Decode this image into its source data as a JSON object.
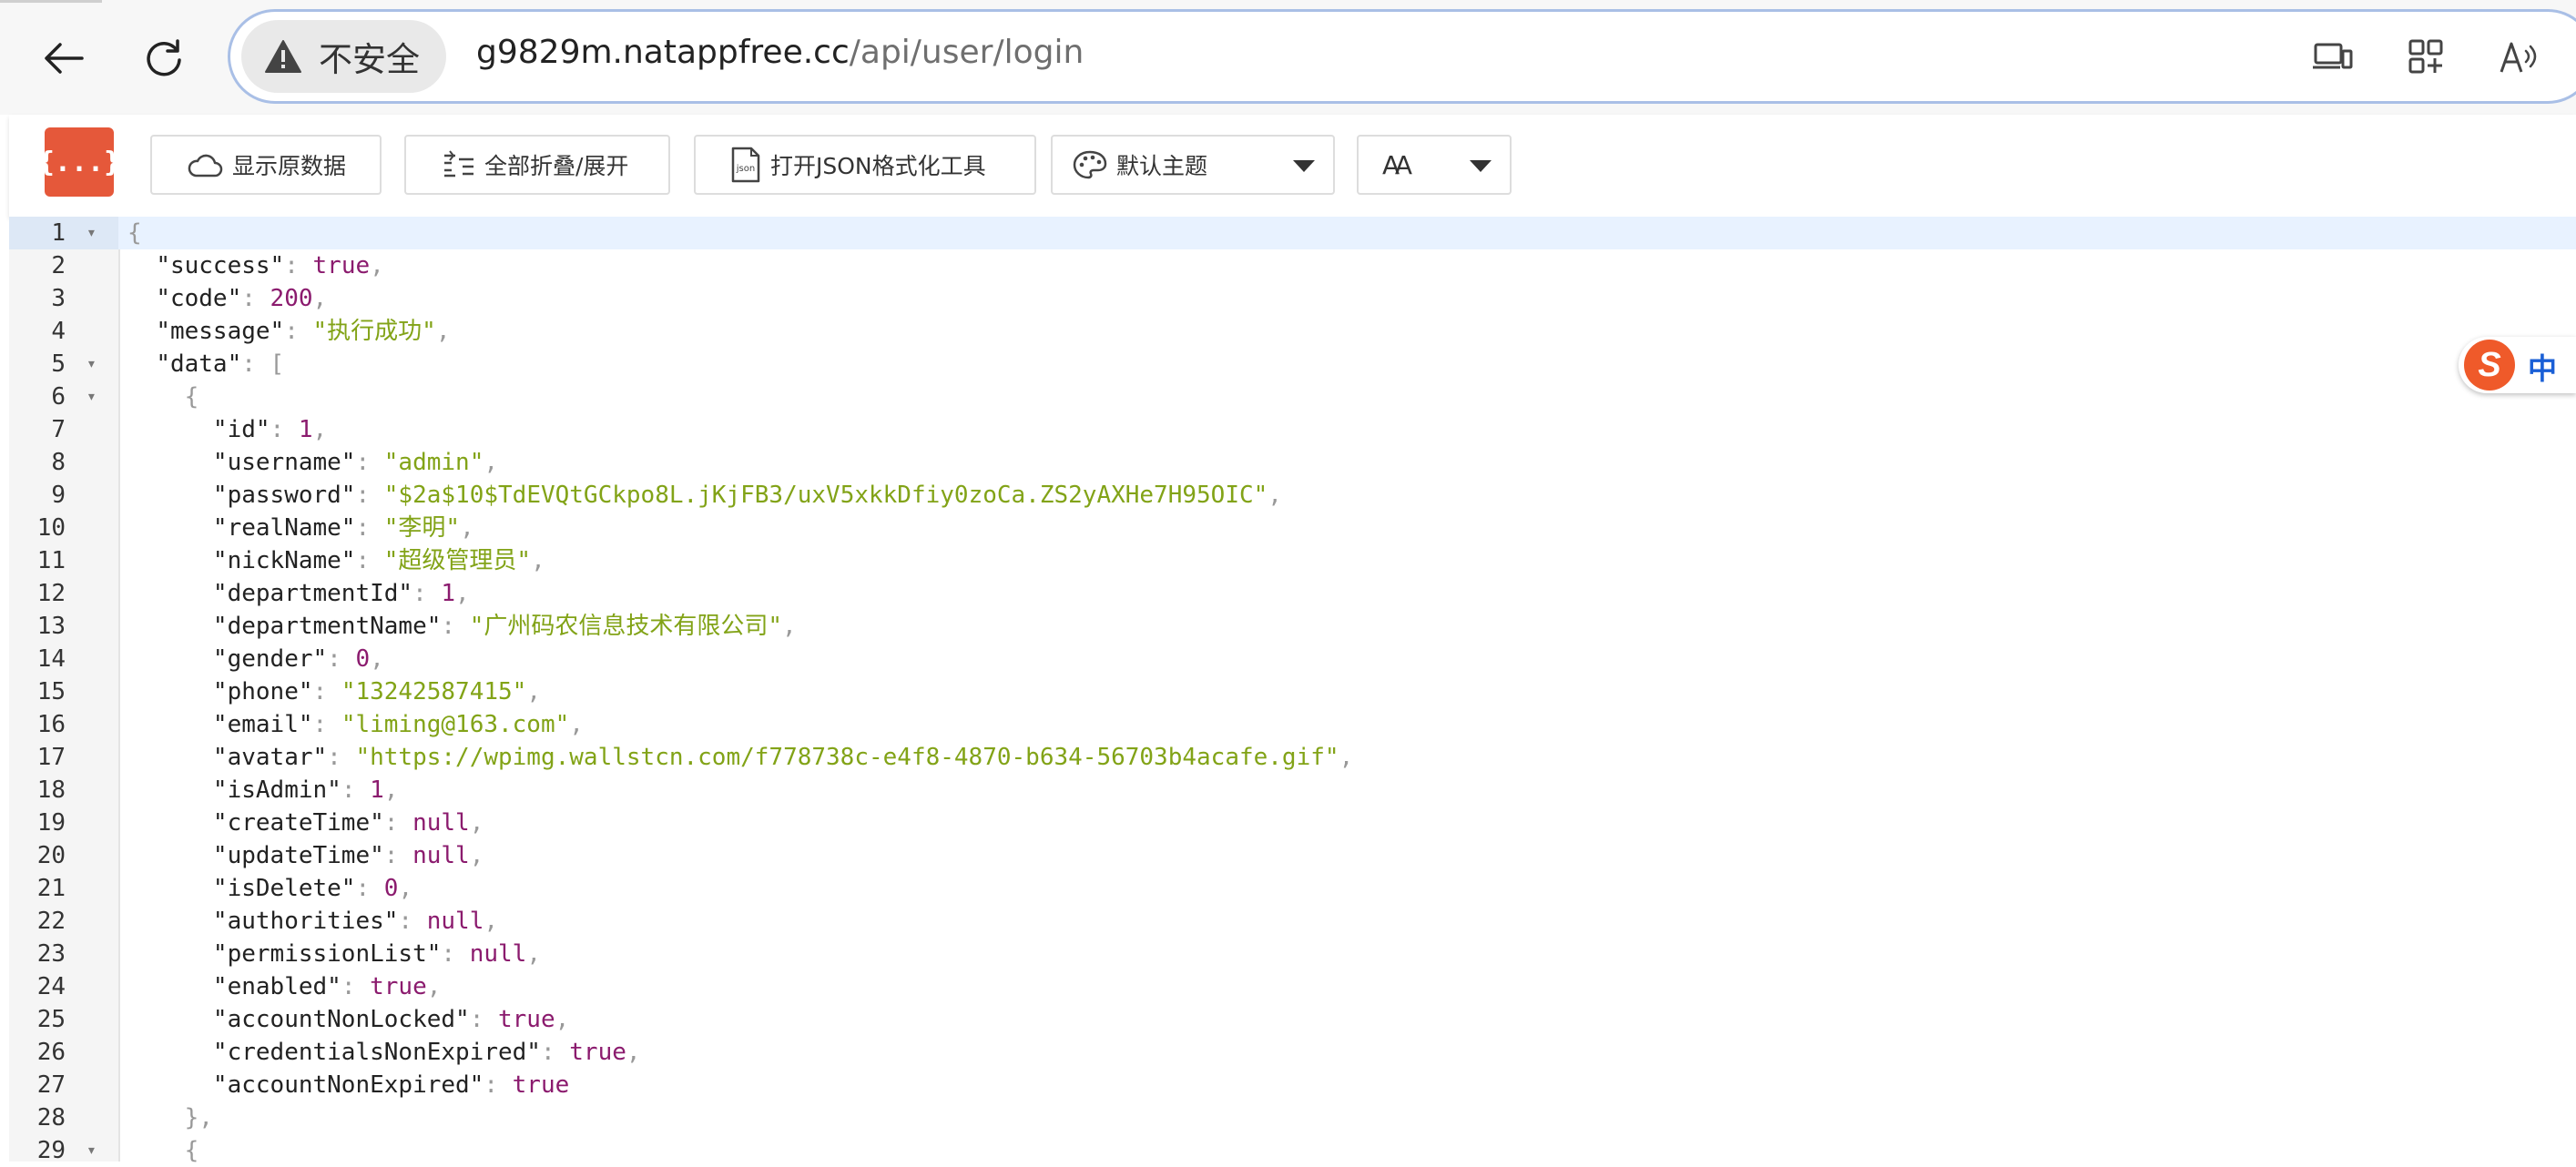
{
  "browser": {
    "security_label": "不安全",
    "url_host": "g9829m.natappfree.cc",
    "url_path": "/api/user/login"
  },
  "toolbar": {
    "logo_text": "{...}",
    "raw_button": "显示原数据",
    "fold_button": "全部折叠/展开",
    "formatter_button": "打开JSON格式化工具",
    "theme_select": "默认主题",
    "font_select": "AA"
  },
  "ime": {
    "logo": "S",
    "mode": "中"
  },
  "code": {
    "lines": [
      {
        "n": "1",
        "fold": "▾",
        "parts": [
          {
            "t": "{",
            "c": "p"
          }
        ]
      },
      {
        "n": "2",
        "fold": "",
        "parts": [
          {
            "t": "  ",
            "c": "p"
          },
          {
            "t": "\"success\"",
            "c": "k"
          },
          {
            "t": ": ",
            "c": "p"
          },
          {
            "t": "true",
            "c": "b"
          },
          {
            "t": ",",
            "c": "p"
          }
        ]
      },
      {
        "n": "3",
        "fold": "",
        "parts": [
          {
            "t": "  ",
            "c": "p"
          },
          {
            "t": "\"code\"",
            "c": "k"
          },
          {
            "t": ": ",
            "c": "p"
          },
          {
            "t": "200",
            "c": "n"
          },
          {
            "t": ",",
            "c": "p"
          }
        ]
      },
      {
        "n": "4",
        "fold": "",
        "parts": [
          {
            "t": "  ",
            "c": "p"
          },
          {
            "t": "\"message\"",
            "c": "k"
          },
          {
            "t": ": ",
            "c": "p"
          },
          {
            "t": "\"执行成功\"",
            "c": "s"
          },
          {
            "t": ",",
            "c": "p"
          }
        ]
      },
      {
        "n": "5",
        "fold": "▾",
        "parts": [
          {
            "t": "  ",
            "c": "p"
          },
          {
            "t": "\"data\"",
            "c": "k"
          },
          {
            "t": ": [",
            "c": "p"
          }
        ]
      },
      {
        "n": "6",
        "fold": "▾",
        "parts": [
          {
            "t": "    {",
            "c": "p"
          }
        ]
      },
      {
        "n": "7",
        "fold": "",
        "parts": [
          {
            "t": "      ",
            "c": "p"
          },
          {
            "t": "\"id\"",
            "c": "k"
          },
          {
            "t": ": ",
            "c": "p"
          },
          {
            "t": "1",
            "c": "n"
          },
          {
            "t": ",",
            "c": "p"
          }
        ]
      },
      {
        "n": "8",
        "fold": "",
        "parts": [
          {
            "t": "      ",
            "c": "p"
          },
          {
            "t": "\"username\"",
            "c": "k"
          },
          {
            "t": ": ",
            "c": "p"
          },
          {
            "t": "\"admin\"",
            "c": "s"
          },
          {
            "t": ",",
            "c": "p"
          }
        ]
      },
      {
        "n": "9",
        "fold": "",
        "parts": [
          {
            "t": "      ",
            "c": "p"
          },
          {
            "t": "\"password\"",
            "c": "k"
          },
          {
            "t": ": ",
            "c": "p"
          },
          {
            "t": "\"$2a$10$TdEVQtGCkpo8L.jKjFB3/uxV5xkkDfiy0zoCa.ZS2yAXHe7H95OIC\"",
            "c": "s"
          },
          {
            "t": ",",
            "c": "p"
          }
        ]
      },
      {
        "n": "10",
        "fold": "",
        "parts": [
          {
            "t": "      ",
            "c": "p"
          },
          {
            "t": "\"realName\"",
            "c": "k"
          },
          {
            "t": ": ",
            "c": "p"
          },
          {
            "t": "\"李明\"",
            "c": "s"
          },
          {
            "t": ",",
            "c": "p"
          }
        ]
      },
      {
        "n": "11",
        "fold": "",
        "parts": [
          {
            "t": "      ",
            "c": "p"
          },
          {
            "t": "\"nickName\"",
            "c": "k"
          },
          {
            "t": ": ",
            "c": "p"
          },
          {
            "t": "\"超级管理员\"",
            "c": "s"
          },
          {
            "t": ",",
            "c": "p"
          }
        ]
      },
      {
        "n": "12",
        "fold": "",
        "parts": [
          {
            "t": "      ",
            "c": "p"
          },
          {
            "t": "\"departmentId\"",
            "c": "k"
          },
          {
            "t": ": ",
            "c": "p"
          },
          {
            "t": "1",
            "c": "n"
          },
          {
            "t": ",",
            "c": "p"
          }
        ]
      },
      {
        "n": "13",
        "fold": "",
        "parts": [
          {
            "t": "      ",
            "c": "p"
          },
          {
            "t": "\"departmentName\"",
            "c": "k"
          },
          {
            "t": ": ",
            "c": "p"
          },
          {
            "t": "\"广州码农信息技术有限公司\"",
            "c": "s"
          },
          {
            "t": ",",
            "c": "p"
          }
        ]
      },
      {
        "n": "14",
        "fold": "",
        "parts": [
          {
            "t": "      ",
            "c": "p"
          },
          {
            "t": "\"gender\"",
            "c": "k"
          },
          {
            "t": ": ",
            "c": "p"
          },
          {
            "t": "0",
            "c": "n"
          },
          {
            "t": ",",
            "c": "p"
          }
        ]
      },
      {
        "n": "15",
        "fold": "",
        "parts": [
          {
            "t": "      ",
            "c": "p"
          },
          {
            "t": "\"phone\"",
            "c": "k"
          },
          {
            "t": ": ",
            "c": "p"
          },
          {
            "t": "\"13242587415\"",
            "c": "s"
          },
          {
            "t": ",",
            "c": "p"
          }
        ]
      },
      {
        "n": "16",
        "fold": "",
        "parts": [
          {
            "t": "      ",
            "c": "p"
          },
          {
            "t": "\"email\"",
            "c": "k"
          },
          {
            "t": ": ",
            "c": "p"
          },
          {
            "t": "\"liming@163.com\"",
            "c": "s"
          },
          {
            "t": ",",
            "c": "p"
          }
        ]
      },
      {
        "n": "17",
        "fold": "",
        "parts": [
          {
            "t": "      ",
            "c": "p"
          },
          {
            "t": "\"avatar\"",
            "c": "k"
          },
          {
            "t": ": ",
            "c": "p"
          },
          {
            "t": "\"https://wpimg.wallstcn.com/f778738c-e4f8-4870-b634-56703b4acafe.gif\"",
            "c": "s"
          },
          {
            "t": ",",
            "c": "p"
          }
        ]
      },
      {
        "n": "18",
        "fold": "",
        "parts": [
          {
            "t": "      ",
            "c": "p"
          },
          {
            "t": "\"isAdmin\"",
            "c": "k"
          },
          {
            "t": ": ",
            "c": "p"
          },
          {
            "t": "1",
            "c": "n"
          },
          {
            "t": ",",
            "c": "p"
          }
        ]
      },
      {
        "n": "19",
        "fold": "",
        "parts": [
          {
            "t": "      ",
            "c": "p"
          },
          {
            "t": "\"createTime\"",
            "c": "k"
          },
          {
            "t": ": ",
            "c": "p"
          },
          {
            "t": "null",
            "c": "z"
          },
          {
            "t": ",",
            "c": "p"
          }
        ]
      },
      {
        "n": "20",
        "fold": "",
        "parts": [
          {
            "t": "      ",
            "c": "p"
          },
          {
            "t": "\"updateTime\"",
            "c": "k"
          },
          {
            "t": ": ",
            "c": "p"
          },
          {
            "t": "null",
            "c": "z"
          },
          {
            "t": ",",
            "c": "p"
          }
        ]
      },
      {
        "n": "21",
        "fold": "",
        "parts": [
          {
            "t": "      ",
            "c": "p"
          },
          {
            "t": "\"isDelete\"",
            "c": "k"
          },
          {
            "t": ": ",
            "c": "p"
          },
          {
            "t": "0",
            "c": "n"
          },
          {
            "t": ",",
            "c": "p"
          }
        ]
      },
      {
        "n": "22",
        "fold": "",
        "parts": [
          {
            "t": "      ",
            "c": "p"
          },
          {
            "t": "\"authorities\"",
            "c": "k"
          },
          {
            "t": ": ",
            "c": "p"
          },
          {
            "t": "null",
            "c": "z"
          },
          {
            "t": ",",
            "c": "p"
          }
        ]
      },
      {
        "n": "23",
        "fold": "",
        "parts": [
          {
            "t": "      ",
            "c": "p"
          },
          {
            "t": "\"permissionList\"",
            "c": "k"
          },
          {
            "t": ": ",
            "c": "p"
          },
          {
            "t": "null",
            "c": "z"
          },
          {
            "t": ",",
            "c": "p"
          }
        ]
      },
      {
        "n": "24",
        "fold": "",
        "parts": [
          {
            "t": "      ",
            "c": "p"
          },
          {
            "t": "\"enabled\"",
            "c": "k"
          },
          {
            "t": ": ",
            "c": "p"
          },
          {
            "t": "true",
            "c": "b"
          },
          {
            "t": ",",
            "c": "p"
          }
        ]
      },
      {
        "n": "25",
        "fold": "",
        "parts": [
          {
            "t": "      ",
            "c": "p"
          },
          {
            "t": "\"accountNonLocked\"",
            "c": "k"
          },
          {
            "t": ": ",
            "c": "p"
          },
          {
            "t": "true",
            "c": "b"
          },
          {
            "t": ",",
            "c": "p"
          }
        ]
      },
      {
        "n": "26",
        "fold": "",
        "parts": [
          {
            "t": "      ",
            "c": "p"
          },
          {
            "t": "\"credentialsNonExpired\"",
            "c": "k"
          },
          {
            "t": ": ",
            "c": "p"
          },
          {
            "t": "true",
            "c": "b"
          },
          {
            "t": ",",
            "c": "p"
          }
        ]
      },
      {
        "n": "27",
        "fold": "",
        "parts": [
          {
            "t": "      ",
            "c": "p"
          },
          {
            "t": "\"accountNonExpired\"",
            "c": "k"
          },
          {
            "t": ": ",
            "c": "p"
          },
          {
            "t": "true",
            "c": "b"
          }
        ]
      },
      {
        "n": "28",
        "fold": "",
        "parts": [
          {
            "t": "    },",
            "c": "p"
          }
        ]
      },
      {
        "n": "29",
        "fold": "▾",
        "parts": [
          {
            "t": "    {",
            "c": "p"
          }
        ]
      }
    ]
  }
}
